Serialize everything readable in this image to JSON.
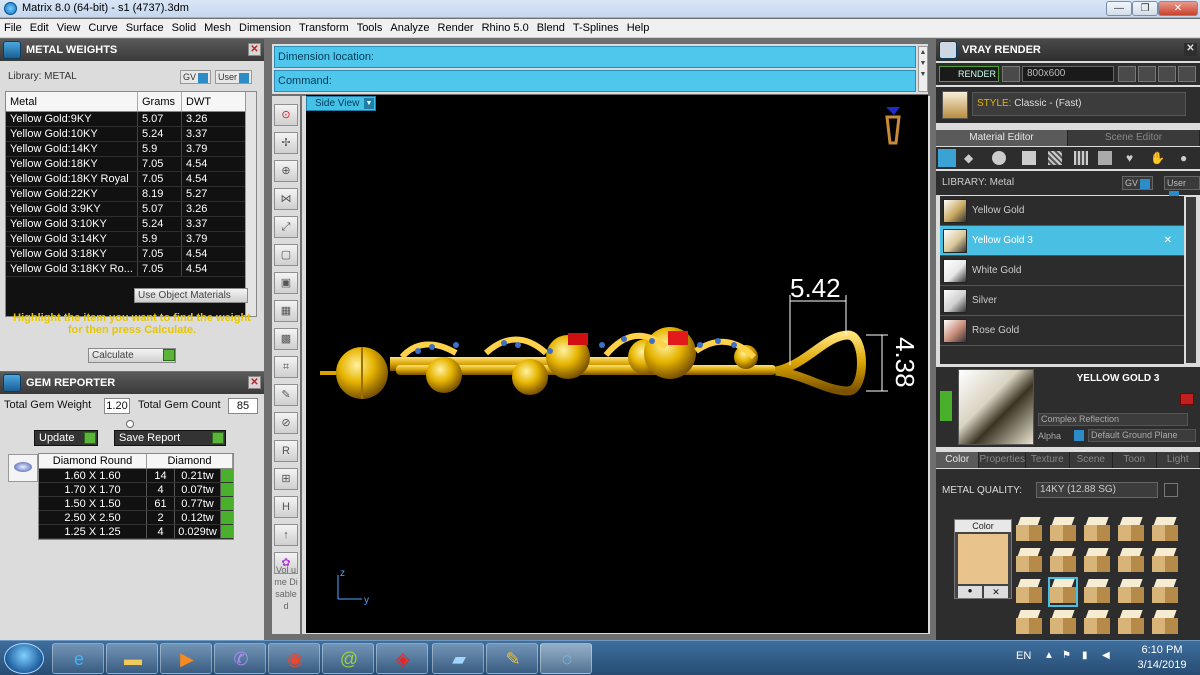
{
  "window": {
    "title": "Matrix 8.0 (64-bit) - s1 (4737).3dm",
    "minimize": "—",
    "restore": "❐",
    "close": "✕"
  },
  "menu": [
    "File",
    "Edit",
    "View",
    "Curve",
    "Surface",
    "Solid",
    "Mesh",
    "Dimension",
    "Transform",
    "Tools",
    "Analyze",
    "Render",
    "Rhino 5.0",
    "Blend",
    "T-Splines",
    "Help"
  ],
  "metal_weights": {
    "title": "METAL WEIGHTS",
    "library": "Library: METAL",
    "gv": "GV",
    "user": "User",
    "headers": [
      "Metal",
      "Grams",
      "DWT"
    ],
    "rows": [
      [
        "Yellow Gold:9KY",
        "5.07",
        "3.26"
      ],
      [
        "Yellow Gold:10KY",
        "5.24",
        "3.37"
      ],
      [
        "Yellow Gold:14KY",
        "5.9",
        "3.79"
      ],
      [
        "Yellow Gold:18KY",
        "7.05",
        "4.54"
      ],
      [
        "Yellow Gold:18KY Royal",
        "7.05",
        "4.54"
      ],
      [
        "Yellow Gold:22KY",
        "8.19",
        "5.27"
      ],
      [
        "Yellow Gold 3:9KY",
        "5.07",
        "3.26"
      ],
      [
        "Yellow Gold 3:10KY",
        "5.24",
        "3.37"
      ],
      [
        "Yellow Gold 3:14KY",
        "5.9",
        "3.79"
      ],
      [
        "Yellow Gold 3:18KY",
        "7.05",
        "4.54"
      ],
      [
        "Yellow Gold 3:18KY Ro...",
        "7.05",
        "4.54"
      ]
    ],
    "use_object_materials": "Use Object Materials",
    "hint": "Highlight the item you want to find the weight for then press Calculate.",
    "calculate": "Calculate"
  },
  "gem_reporter": {
    "title": "GEM REPORTER",
    "total_weight_label": "Total Gem Weight",
    "total_weight": "1.20",
    "total_count_label": "Total Gem Count",
    "total_count": "85",
    "update": "Update",
    "save_report": "Save Report",
    "headers": [
      "Diamond Round",
      "Diamond"
    ],
    "rows": [
      [
        "1.60 X 1.60",
        "14",
        "0.21tw"
      ],
      [
        "1.70 X 1.70",
        "4",
        "0.07tw"
      ],
      [
        "1.50 X 1.50",
        "61",
        "0.77tw"
      ],
      [
        "2.50 X 2.50",
        "2",
        "0.12tw"
      ],
      [
        "1.25 X 1.25",
        "4",
        "0.029tw"
      ]
    ]
  },
  "command": {
    "line1": "Dimension location:",
    "line2": "Command:"
  },
  "viewport": {
    "view_name": "Side View",
    "dim_horizontal": "5.42",
    "dim_vertical": "4.38",
    "axis_z": "z",
    "axis_y": "y",
    "volume_label": "Vol ume Disabled"
  },
  "tool_icons": [
    "record-icon",
    "line-icon",
    "sphere-icon",
    "network-icon",
    "transform-icon",
    "box-icon",
    "box-wire-icon",
    "box-grid-icon",
    "box-edge-icon",
    "array-icon",
    "pen-icon",
    "off-icon",
    "render-icon",
    "move-icon",
    "hidden-icon",
    "arrow-icon",
    "gem-icon"
  ],
  "vray": {
    "title": "VRAY RENDER",
    "render_btn": "RENDER",
    "resolution": "800x600",
    "style_label": "STYLE:",
    "style_value": "Classic - (Fast)",
    "tabs": [
      "Material Editor",
      "Scene Editor"
    ],
    "library": "LIBRARY: Metal",
    "gv": "GV",
    "user": "User",
    "materials": [
      "Yellow Gold",
      "Yellow Gold 3",
      "White Gold",
      "Silver",
      "Rose Gold"
    ],
    "selected_material": "YELLOW GOLD 3",
    "reflection": "Complex Reflection",
    "alpha": "Alpha",
    "ground": "Default Ground Plane",
    "subtabs": [
      "Color",
      "Properties",
      "Texture",
      "Scene",
      "Toon",
      "Light"
    ],
    "metal_quality_label": "METAL QUALITY:",
    "metal_quality": "14KY",
    "metal_quality_sg": "(12.88 SG)",
    "color_label": "Color",
    "swatch_color": "#e8c48c"
  },
  "taskbar": {
    "lang": "EN",
    "time": "6:10 PM",
    "date": "3/14/2019"
  }
}
